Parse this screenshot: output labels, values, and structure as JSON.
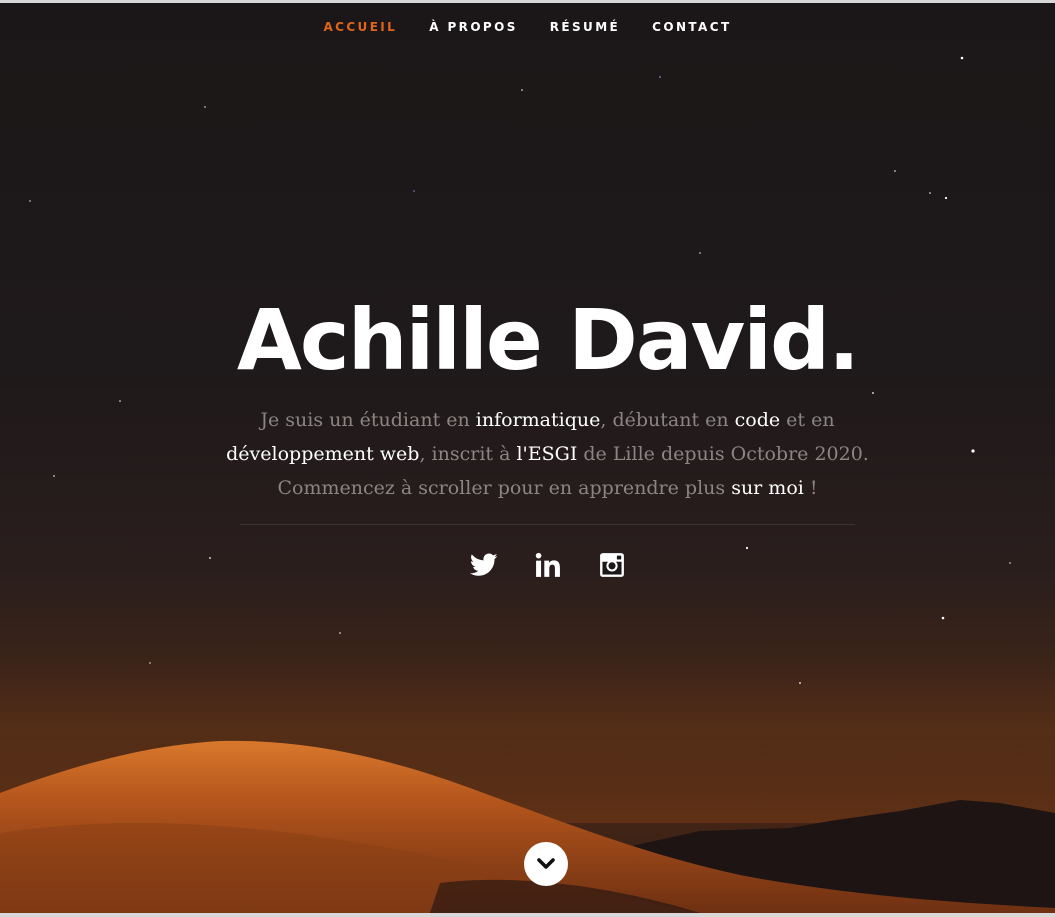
{
  "nav": {
    "items": [
      {
        "label": "Accueil",
        "active": true
      },
      {
        "label": "À propos",
        "active": false
      },
      {
        "label": "Résumé",
        "active": false
      },
      {
        "label": "Contact",
        "active": false
      }
    ]
  },
  "hero": {
    "title": "Achille David.",
    "intro": {
      "p1": "Je suis un étudiant en ",
      "h1": "informatique",
      "p2": ", débutant en ",
      "h2": "code",
      "p3": " et en ",
      "h3": "développement web",
      "p4": ", inscrit à ",
      "h4": "l'ESGI",
      "p5": " de Lille depuis Octobre 2020. Commencez à scroller pour en apprendre plus ",
      "h5": "sur moi",
      "p6": " !"
    }
  },
  "social": [
    {
      "icon": "twitter-icon"
    },
    {
      "icon": "linkedin-icon"
    },
    {
      "icon": "instagram-icon"
    }
  ],
  "scroll_button": {
    "icon": "chevron-down-icon"
  },
  "colors": {
    "accent": "#e0651c",
    "background": "#1c1819",
    "text_muted": "#8b8584",
    "text_highlight": "#ffffff"
  }
}
